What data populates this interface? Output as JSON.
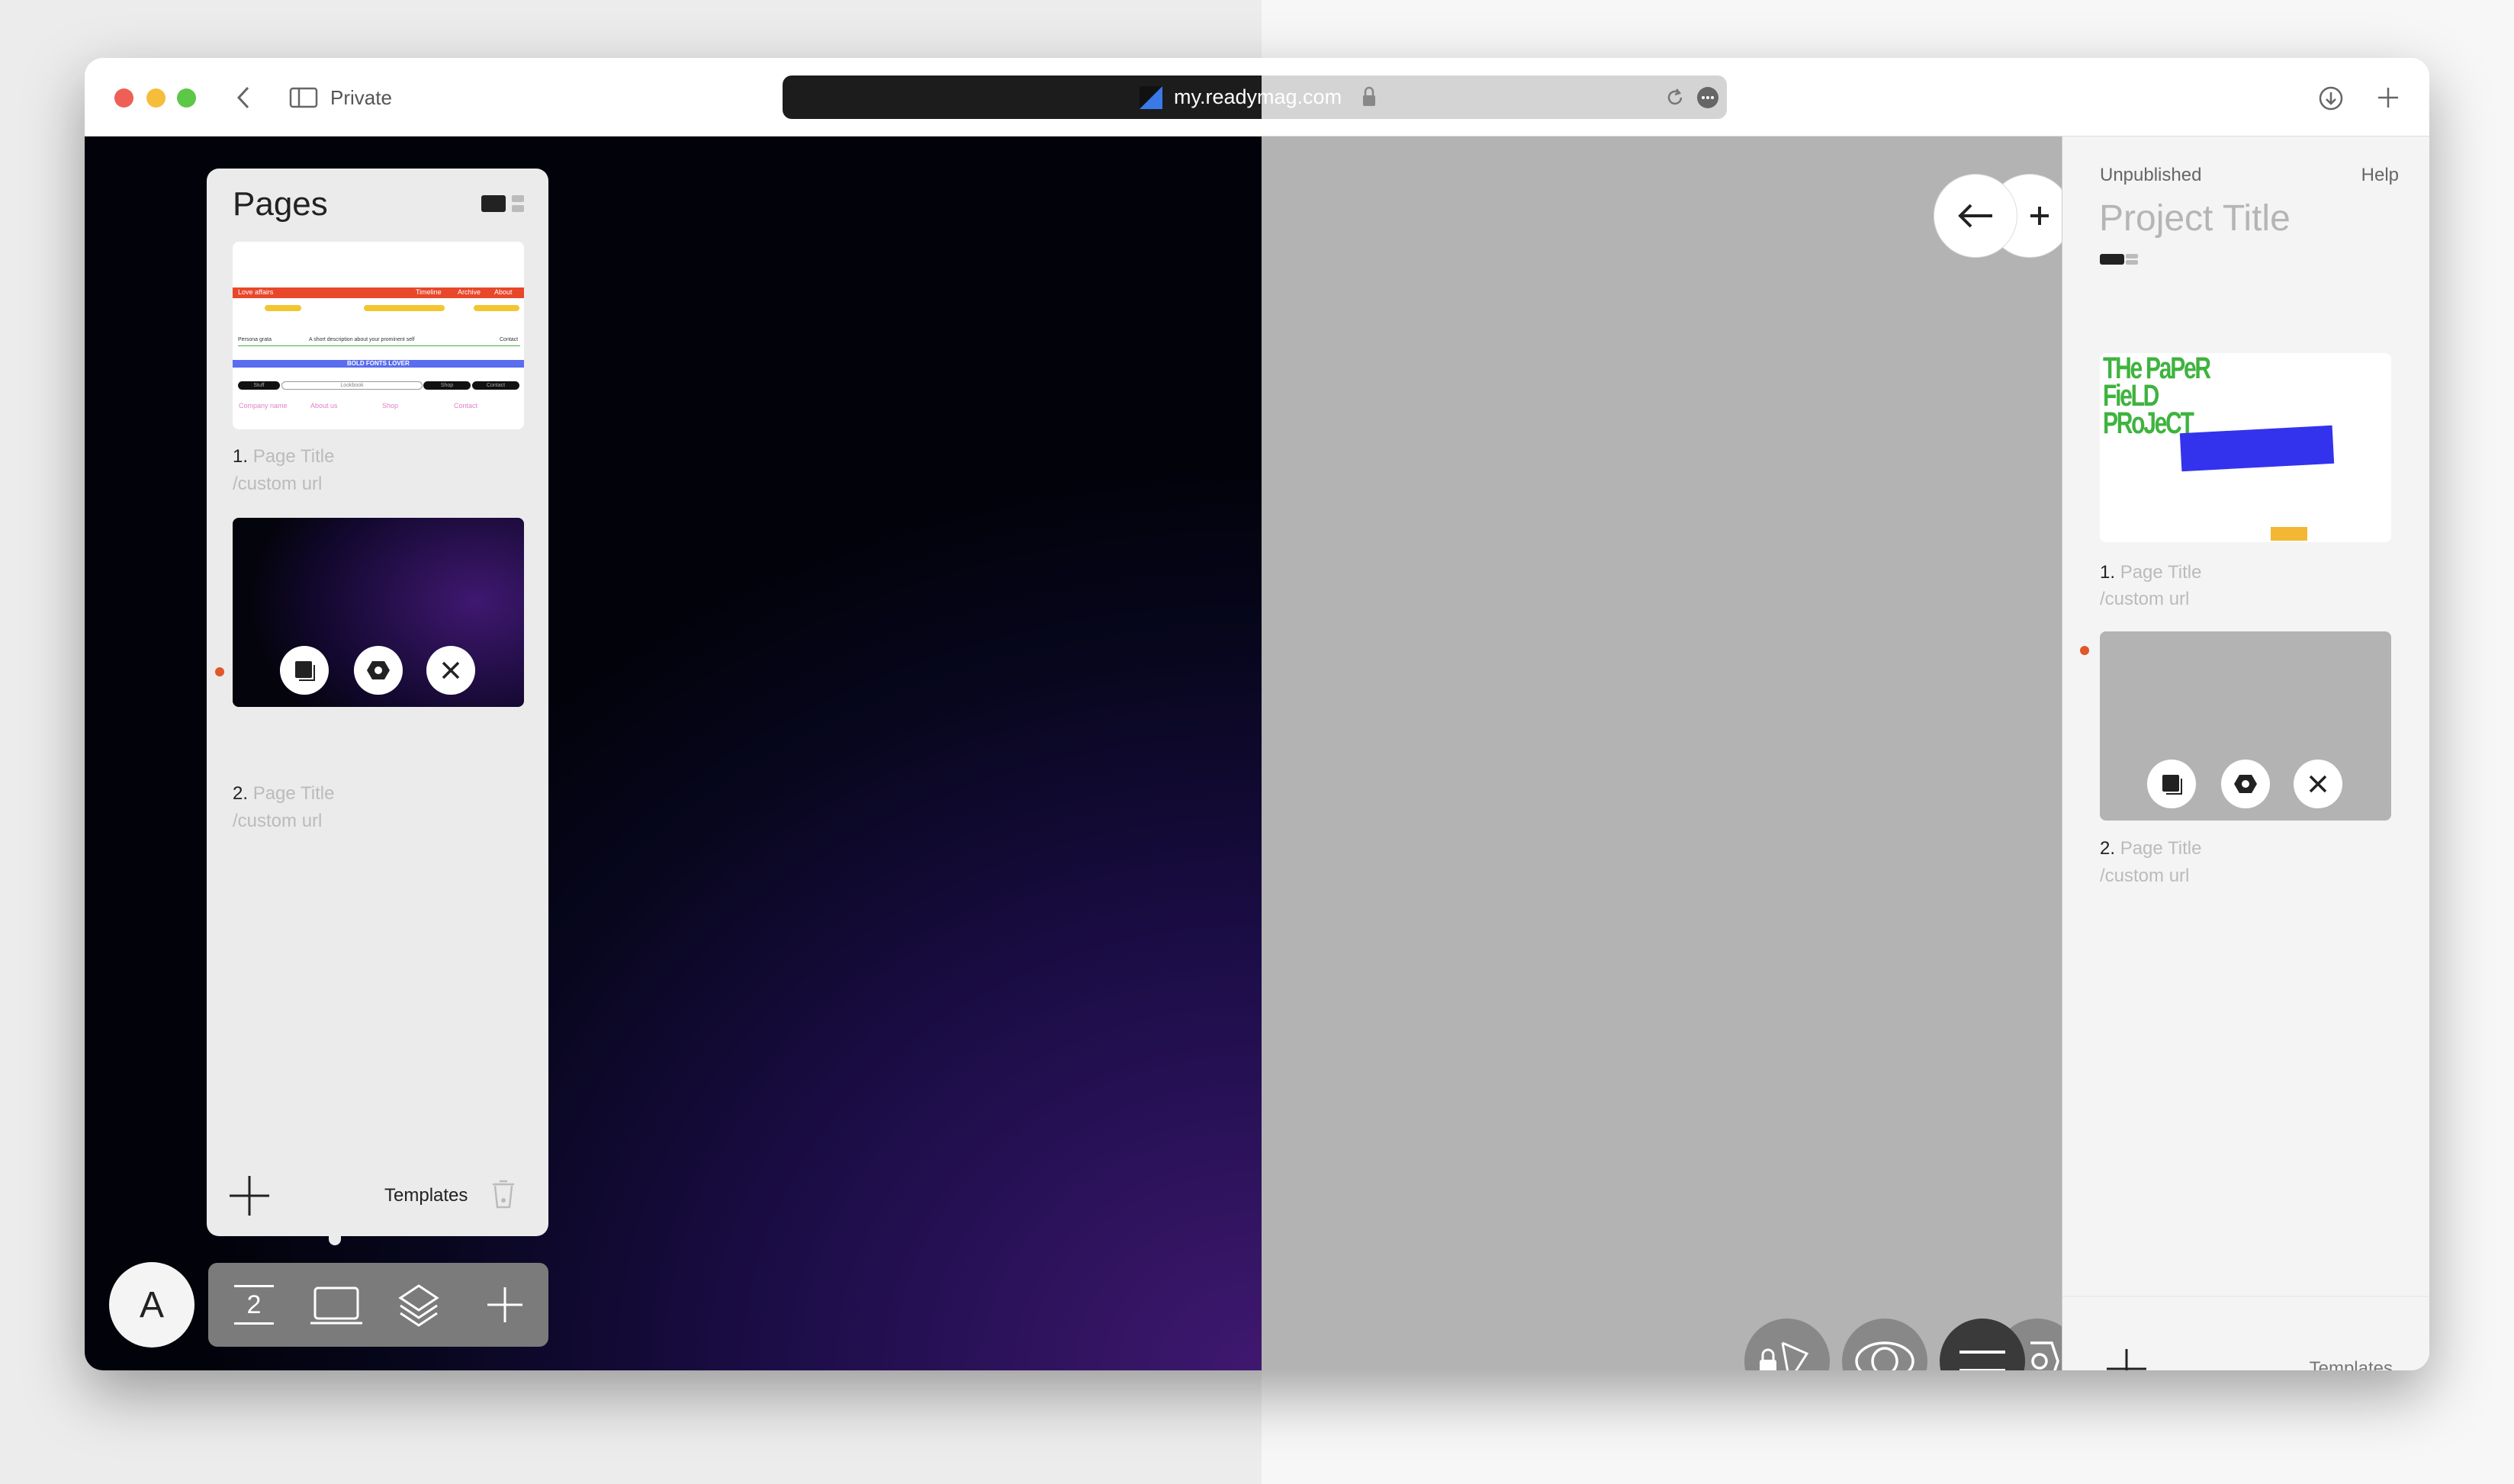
{
  "browser": {
    "mode_label": "Private",
    "url": "my.readymag.com",
    "icons": [
      "back-chevron-icon",
      "sidebar-icon",
      "lock-icon",
      "reload-icon",
      "more-icon",
      "download-icon",
      "new-tab-plus-icon"
    ]
  },
  "pages_panel": {
    "title": "Pages",
    "pages": [
      {
        "number": "1.",
        "title": "Page Title",
        "url": "/custom url"
      },
      {
        "number": "2.",
        "title": "Page Title",
        "url": "/custom url"
      }
    ],
    "templates_label": "Templates"
  },
  "thumb1": {
    "bar1_left": "Love affairs",
    "bar1_links": [
      "Timeline",
      "Archive",
      "About"
    ],
    "row_left": "Persona grata",
    "row_mid": "A short description about your prominent self",
    "row_right": "Contact",
    "bar2_center": "BOLD FONTS LOVER",
    "pills": [
      "Stuff",
      "Lookbook",
      "Shop",
      "Contact"
    ],
    "links": [
      "Company name",
      "About us",
      "Shop",
      "Contact"
    ]
  },
  "toolbar": {
    "avatar_letter": "A",
    "page_number": "2"
  },
  "right_panel": {
    "status": "Unpublished",
    "help": "Help",
    "project_title": "Project Title",
    "thumb_title": "THe PaPeR FieLD PRoJeCT",
    "pages": [
      {
        "number": "1.",
        "title": "Page Title",
        "url": "/custom url"
      },
      {
        "number": "2.",
        "title": "Page Title",
        "url": "/custom url"
      }
    ],
    "templates_label": "Templates"
  },
  "colors": {
    "accent_dot": "#e0572a",
    "thumb_red": "#e8472a",
    "thumb_blue": "#3a3af0",
    "thumb_green": "#3fb33f"
  }
}
